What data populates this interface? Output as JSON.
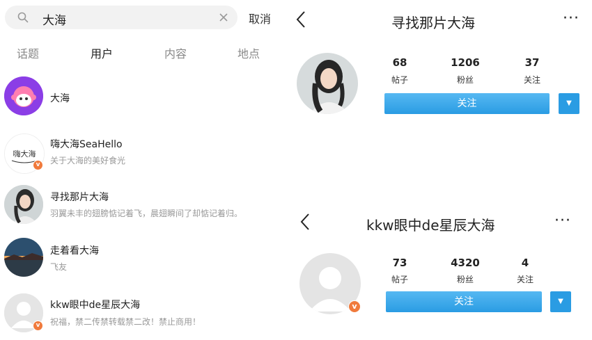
{
  "search": {
    "query": "大海",
    "cancel_label": "取消"
  },
  "tabs": [
    {
      "label": "话题"
    },
    {
      "label": "用户"
    },
    {
      "label": "内容"
    },
    {
      "label": "地点"
    }
  ],
  "results": [
    {
      "name": "大海",
      "desc": ""
    },
    {
      "name": "嗨大海SeaHello",
      "desc": "关于大海的美好食光",
      "avatar_text": "嗨大海",
      "verified": true
    },
    {
      "name": "寻找那片大海",
      "desc": "羽翼未丰的翅膀惦记着飞，晨翅瞬间了却惦记着归。"
    },
    {
      "name": "走着看大海",
      "desc": "飞友"
    },
    {
      "name": "kkw眼中de星辰大海",
      "desc": "祝福，禁二传禁转载禁二改！禁止商用！",
      "verified": true
    }
  ],
  "profile1": {
    "title": "寻找那片大海",
    "more": "···",
    "stats": [
      {
        "num": "68",
        "label": "帖子"
      },
      {
        "num": "1206",
        "label": "粉丝"
      },
      {
        "num": "37",
        "label": "关注"
      }
    ],
    "follow_label": "关注"
  },
  "profile2": {
    "title": "kkw眼中de星辰大海",
    "more": "···",
    "stats": [
      {
        "num": "73",
        "label": "帖子"
      },
      {
        "num": "4320",
        "label": "粉丝"
      },
      {
        "num": "4",
        "label": "关注"
      }
    ],
    "follow_label": "关注"
  },
  "colors": {
    "accent": "#2a9ce3",
    "verified_badge": "#f07a3c"
  }
}
